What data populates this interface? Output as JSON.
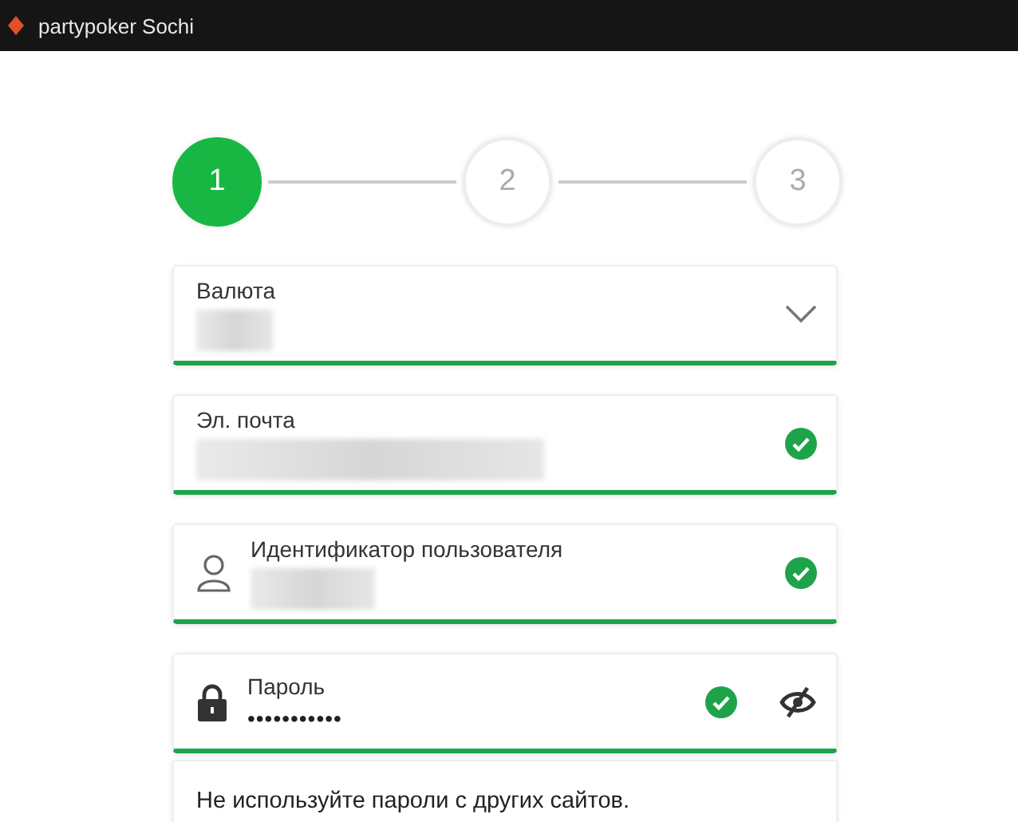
{
  "window": {
    "title": "partypoker Sochi"
  },
  "steps": [
    {
      "label": "1",
      "selected": true
    },
    {
      "label": "2",
      "selected": false
    },
    {
      "label": "3",
      "selected": false
    }
  ],
  "fields": [
    {
      "kind": "select",
      "label": "Валюта",
      "valid": false,
      "blurred": true
    },
    {
      "kind": "email",
      "label": "Эл. почта",
      "valid": true,
      "blurred": true
    },
    {
      "kind": "user",
      "label": "Идентификатор пользователя",
      "valid": true,
      "blurred": true
    },
    {
      "kind": "password",
      "label": "Пароль",
      "valid": true,
      "value": "•••••••••••"
    }
  ],
  "hint": "Не используйте пароли с других сайтов."
}
